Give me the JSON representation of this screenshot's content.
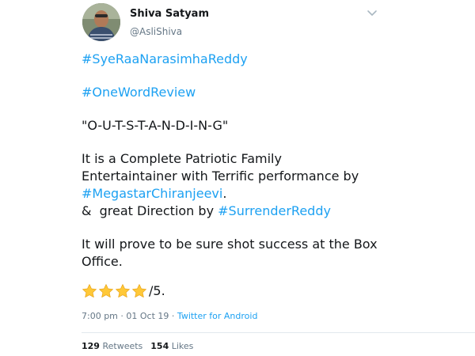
{
  "author": {
    "display_name": "Shiva Satyam",
    "handle": "@AsliShiva",
    "avatar_icon": "profile-photo",
    "menu_icon": "chevron-down-icon"
  },
  "tweet": {
    "hashtag_1": "#SyeRaaNarasimhaReddy",
    "hashtag_2": "#OneWordReview",
    "headline": "\"O-U-T-S-T-A-N-D-I-N-G\"",
    "para1_line1": "It is a Complete Patriotic Family",
    "para1_line2": "Entertaintainer with Terrific performance by",
    "hashtag_3": "#MegastarChiranjeevi",
    "hashtag_3_suffix": ".",
    "para1_line4_prefix": "&  great Direction by ",
    "hashtag_4": "#SurrenderReddy",
    "para2_line1": "It will prove to be sure shot success at the Box",
    "para2_line2": "Office.",
    "rating_stars": 4,
    "rating_suffix": "/5."
  },
  "meta": {
    "time": "7:00 pm",
    "separator": " · ",
    "date": "01 Oct 19",
    "source_separator": " · ",
    "source": "Twitter for Android"
  },
  "stats": {
    "retweets_count": "129",
    "retweets_label": "Retweets",
    "likes_count": "154",
    "likes_label": "Likes"
  },
  "colors": {
    "link": "#1da1f2",
    "text": "#14171a",
    "muted": "#657786",
    "star": "#ffc838"
  }
}
